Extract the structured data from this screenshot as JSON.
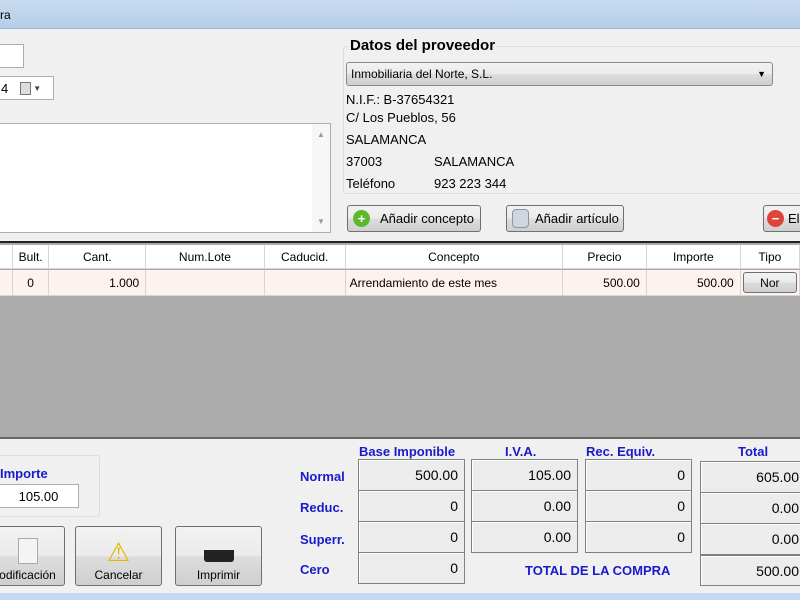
{
  "window": {
    "title_fragment": "ra"
  },
  "left": {
    "field_value": "",
    "date_value": "4",
    "notes": ""
  },
  "supplier": {
    "heading": "Datos del proveedor",
    "selected": "Inmobiliaria del Norte, S.L.",
    "nif": "N.I.F.: B-37654321",
    "address": "C/ Los Pueblos, 56",
    "city": "SALAMANCA",
    "postal_code": "37003",
    "postal_city": "SALAMANCA",
    "phone_label": "Teléfono",
    "phone": "923 223 344"
  },
  "toolbar": {
    "add_concept": "Añadir concepto",
    "add_article": "Añadir artículo",
    "delete": "El"
  },
  "grid": {
    "headers": [
      "",
      "Bult.",
      "Cant.",
      "Num.Lote",
      "Caducid.",
      "Concepto",
      "Precio",
      "Importe",
      "Tipo"
    ],
    "rows": [
      {
        "bult": "0",
        "cant": "1.000",
        "lote": "",
        "caducid": "",
        "concepto": "Arrendamiento de este mes",
        "precio": "500.00",
        "importe": "500.00",
        "tipo": "Nor"
      }
    ]
  },
  "importe": {
    "label": "Importe",
    "value": "105.00"
  },
  "actions": {
    "modify": "odificación",
    "cancel": "Cancelar",
    "print": "Imprimir"
  },
  "totals": {
    "headers": {
      "base": "Base Imponible",
      "iva": "I.V.A.",
      "rec": "Rec. Equiv.",
      "total": "Total"
    },
    "rows": [
      {
        "label": "Normal",
        "base": "500.00",
        "iva": "105.00",
        "rec": "0",
        "total": "605.00"
      },
      {
        "label": "Reduc.",
        "base": "0",
        "iva": "0.00",
        "rec": "0",
        "total": "0.00"
      },
      {
        "label": "Superr.",
        "base": "0",
        "iva": "0.00",
        "rec": "0",
        "total": "0.00"
      },
      {
        "label": "Cero",
        "base": "0"
      }
    ],
    "grand_label": "TOTAL DE LA COMPRA",
    "grand_value": "500.00"
  },
  "colors": {
    "label_blue": "#1a1acc",
    "row_highlight": "#fdf2ee",
    "grid_bg": "#ababab"
  }
}
